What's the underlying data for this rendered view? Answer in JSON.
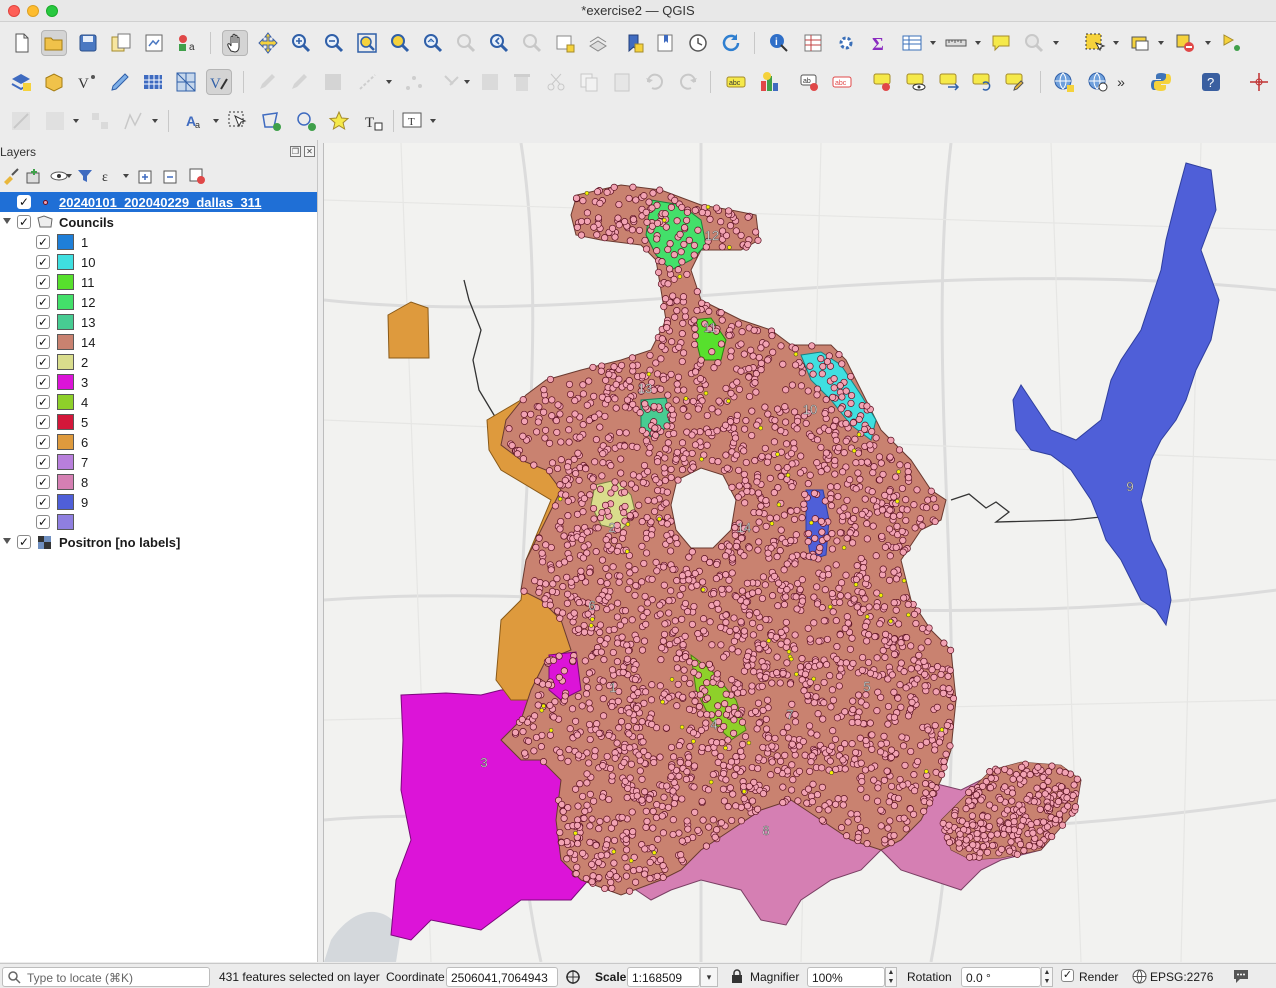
{
  "window": {
    "title": "*exercise2 — QGIS"
  },
  "toolbar_icons": {
    "row1": [
      "new-project-icon",
      "open-project-icon",
      "save-project-icon",
      "save-as-icon",
      "print-layout-icon",
      "style-manager-icon",
      "pan-icon",
      "pan-to-selection-icon",
      "zoom-in-icon",
      "zoom-out-icon",
      "zoom-full-icon",
      "zoom-to-selection-icon",
      "zoom-to-layer-icon",
      "zoom-native-icon",
      "zoom-last-icon",
      "zoom-next-icon",
      "new-map-view-icon",
      "new-3d-view-icon",
      "new-bookmark-icon",
      "show-bookmarks-icon",
      "temporal-controller-icon",
      "refresh-icon",
      "identify-icon",
      "open-field-calculator-icon",
      "processing-toolbox-icon",
      "statistics-icon",
      "open-attribute-table-icon",
      "measure-icon",
      "map-tips-icon",
      "locator-icon",
      "select-features-icon",
      "deselect-icon",
      "new-layer-icon",
      "annotation-icon"
    ],
    "row2": [
      "data-source-manager-icon",
      "new-geopackage-icon",
      "new-virtual-layer-icon",
      "digitize-icon",
      "georeferencer-icon",
      "mesh-icon",
      "toggle-editing-icon",
      "current-edits-icon",
      "save-edits-icon",
      "add-feature-icon",
      "vertex-tool-icon",
      "move-feature-icon",
      "delete-selected-icon",
      "cut-icon",
      "copy-icon",
      "paste-icon",
      "undo-icon",
      "redo-icon",
      "label-icon",
      "diagram-icon",
      "label-highlight-icon",
      "label-disabled-icon",
      "pin-label-icon",
      "show-labels-icon",
      "move-label-icon",
      "rotate-label-icon",
      "change-label-icon",
      "wms-icon",
      "wfs-icon",
      "python-icon",
      "help-icon",
      "crosshair-icon"
    ],
    "row3": [
      "advanced-digitizing-icon",
      "reshape-icon",
      "split-features-icon",
      "simplify-icon",
      "label-tool-icon",
      "select-tool-icon",
      "add-polygon-icon",
      "add-ring-icon",
      "star-icon",
      "text-annotation-icon",
      "text-format-icon"
    ]
  },
  "layers_panel": {
    "title": "Layers",
    "point_layer": "20240101_202040229_dallas_311",
    "group_layer": "Councils",
    "councils": [
      {
        "label": "1",
        "color": "#1f7fd8"
      },
      {
        "label": "10",
        "color": "#3fdfe0"
      },
      {
        "label": "11",
        "color": "#57e02d"
      },
      {
        "label": "12",
        "color": "#43e06a"
      },
      {
        "label": "13",
        "color": "#47cc92"
      },
      {
        "label": "14",
        "color": "#c98270"
      },
      {
        "label": "2",
        "color": "#d9dd8c"
      },
      {
        "label": "3",
        "color": "#dc14d8"
      },
      {
        "label": "4",
        "color": "#8ed02a"
      },
      {
        "label": "5",
        "color": "#d4173a"
      },
      {
        "label": "6",
        "color": "#de9a3d"
      },
      {
        "label": "7",
        "color": "#b87fdc"
      },
      {
        "label": "8",
        "color": "#d57fb3"
      },
      {
        "label": "9",
        "color": "#4f5fd8"
      },
      {
        "label": "",
        "color": "#8f7fe0"
      }
    ],
    "basemap_layer": "Positron [no labels]"
  },
  "map": {
    "council_labels": [
      "12",
      "11",
      "13",
      "10",
      "9",
      "2",
      "14",
      "6",
      "1",
      "5",
      "7",
      "4",
      "3",
      "8"
    ],
    "point_color": "#f2a3b3",
    "selected_color": "#f5f000"
  },
  "statusbar": {
    "locate_placeholder": "Type to locate (⌘K)",
    "message": "431 features selected on layer",
    "coordinate_label": "Coordinate",
    "coordinate_value": "2506041,7064943",
    "scale_label": "Scale",
    "scale_value": "1:168509",
    "magnifier_label": "Magnifier",
    "magnifier_value": "100%",
    "rotation_label": "Rotation",
    "rotation_value": "0.0 °",
    "render_label": "Render",
    "crs": "EPSG:2276"
  }
}
